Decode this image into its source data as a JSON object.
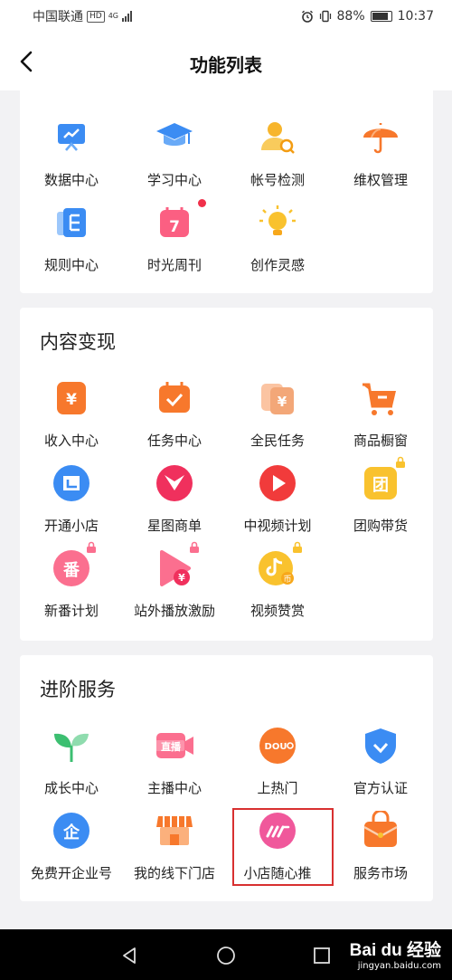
{
  "status_bar": {
    "carrier": "中国联通",
    "hd_badge": "HD",
    "network": "4G",
    "battery_percent": "88%",
    "time": "10:37"
  },
  "header": {
    "title": "功能列表"
  },
  "section_top": {
    "items": [
      {
        "label": "数据中心",
        "icon": "data-center-icon"
      },
      {
        "label": "学习中心",
        "icon": "graduation-cap-icon"
      },
      {
        "label": "帐号检测",
        "icon": "account-check-icon"
      },
      {
        "label": "维权管理",
        "icon": "umbrella-icon"
      },
      {
        "label": "规则中心",
        "icon": "rules-book-icon"
      },
      {
        "label": "时光周刊",
        "icon": "calendar-7-icon",
        "has_dot": true
      },
      {
        "label": "创作灵感",
        "icon": "lightbulb-icon"
      }
    ]
  },
  "section_monetize": {
    "title": "内容变现",
    "items": [
      {
        "label": "收入中心",
        "icon": "income-yen-icon"
      },
      {
        "label": "任务中心",
        "icon": "task-calendar-icon"
      },
      {
        "label": "全民任务",
        "icon": "stacked-yen-icon"
      },
      {
        "label": "商品橱窗",
        "icon": "shopping-cart-icon"
      },
      {
        "label": "开通小店",
        "icon": "open-shop-icon"
      },
      {
        "label": "星图商单",
        "icon": "star-map-icon"
      },
      {
        "label": "中视频计划",
        "icon": "video-play-icon"
      },
      {
        "label": "团购带货",
        "icon": "group-buy-icon",
        "locked": true
      },
      {
        "label": "新番计划",
        "icon": "new-anime-icon",
        "locked": true
      },
      {
        "label": "站外播放激励",
        "icon": "external-play-icon",
        "locked": true
      },
      {
        "label": "视频赞赏",
        "icon": "video-tip-icon",
        "locked": true
      }
    ]
  },
  "section_advanced": {
    "title": "进阶服务",
    "items": [
      {
        "label": "成长中心",
        "icon": "sprout-icon"
      },
      {
        "label": "主播中心",
        "icon": "live-streamer-icon"
      },
      {
        "label": "上热门",
        "icon": "dou-plus-icon"
      },
      {
        "label": "官方认证",
        "icon": "verified-shield-icon"
      },
      {
        "label": "免费开企业号",
        "icon": "enterprise-icon"
      },
      {
        "label": "我的线下门店",
        "icon": "storefront-icon"
      },
      {
        "label": "小店随心推",
        "icon": "shop-promote-icon"
      },
      {
        "label": "服务市场",
        "icon": "service-market-icon"
      }
    ]
  },
  "watermark": {
    "logo": "Bai du 经验",
    "url": "jingyan.baidu.com"
  }
}
